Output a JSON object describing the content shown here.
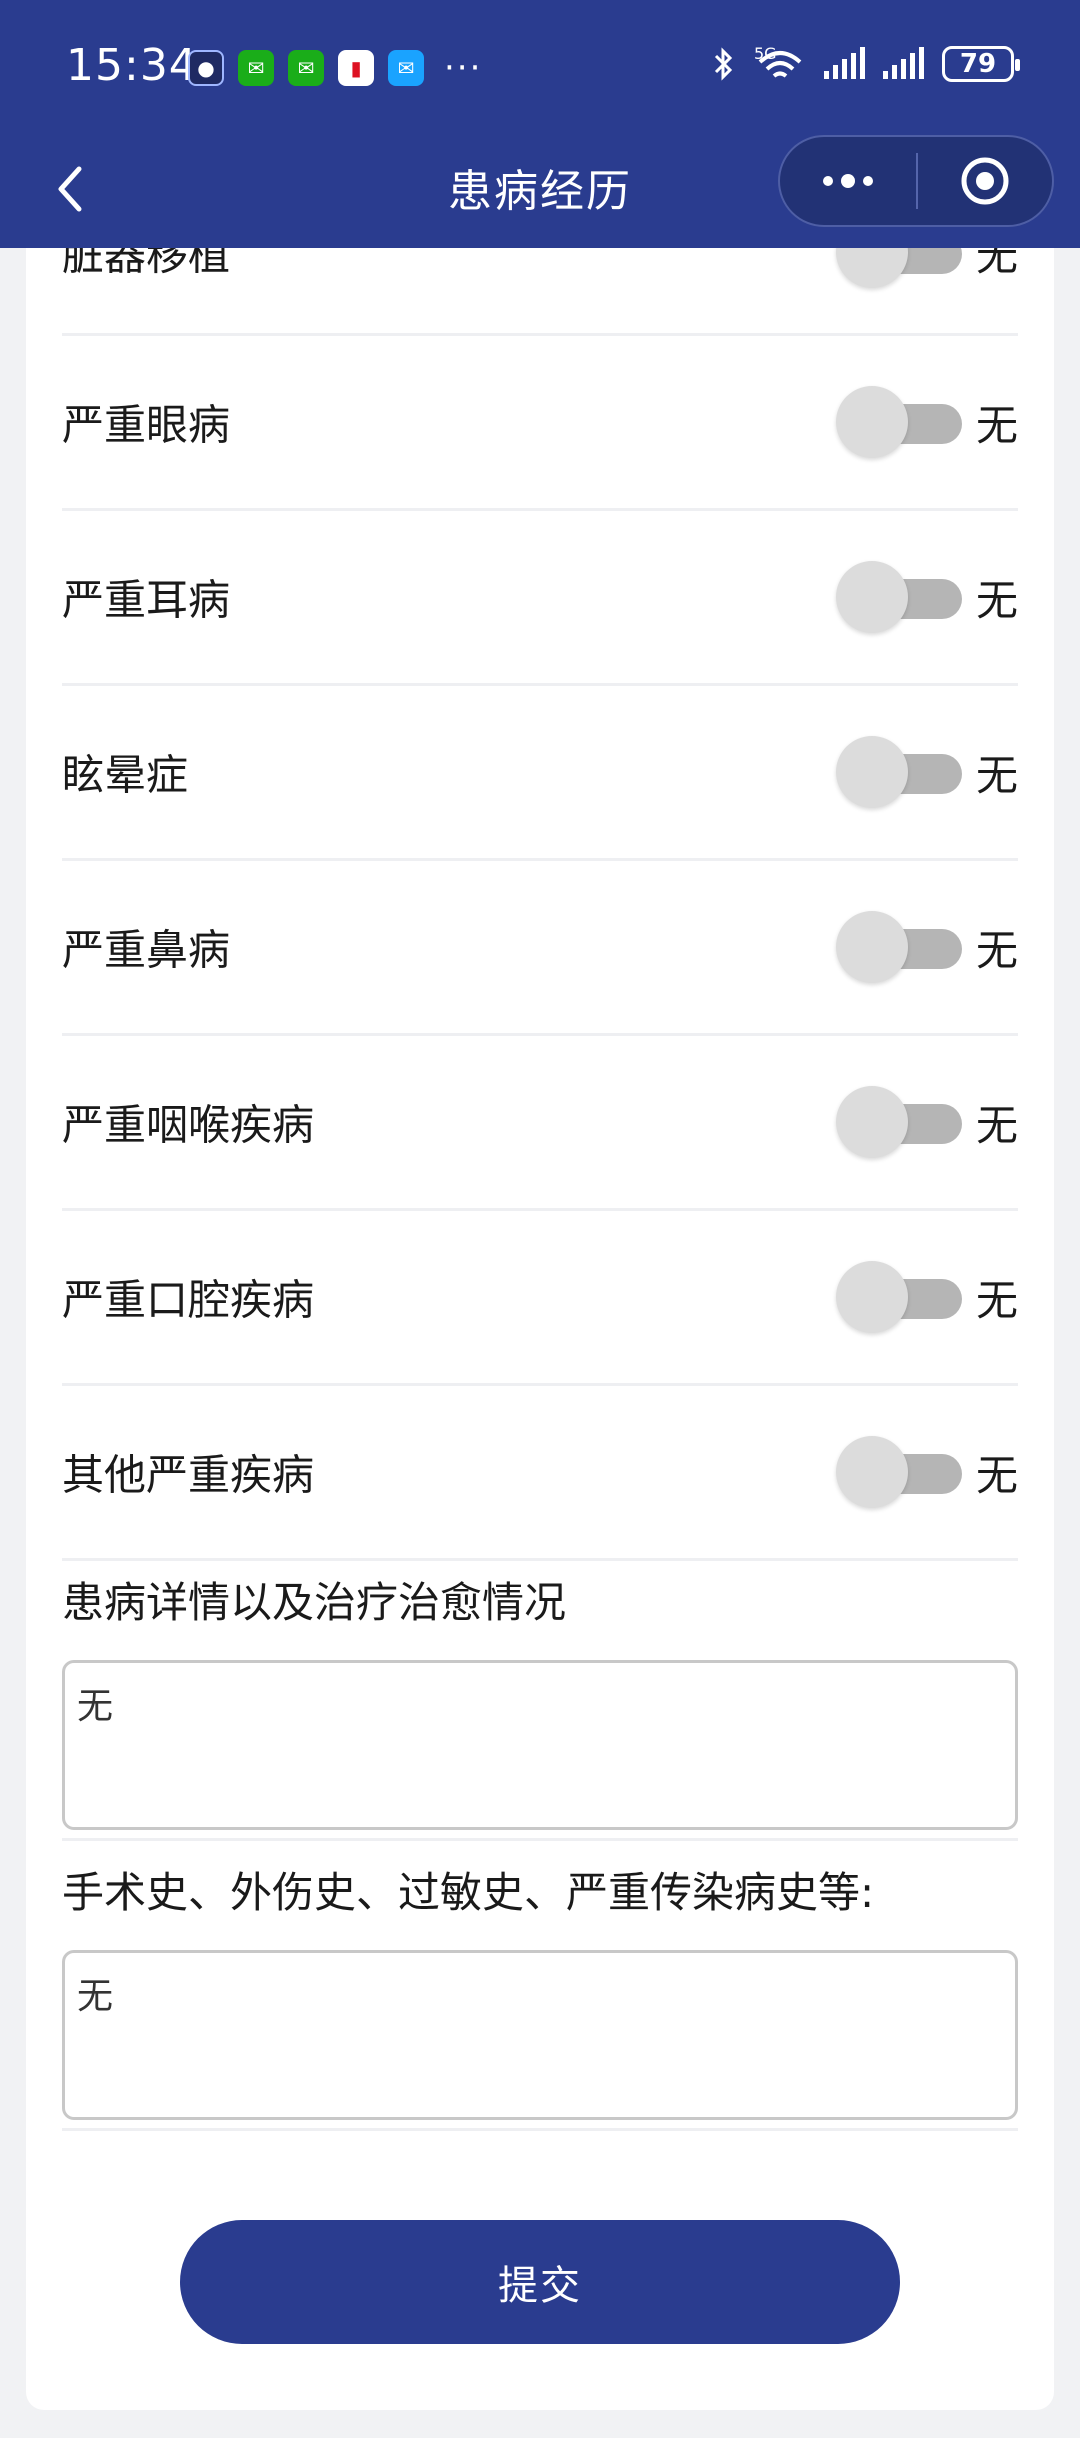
{
  "status_bar": {
    "time": "15:34",
    "more_indicator": "···",
    "battery": "79",
    "network_label": "5G"
  },
  "nav": {
    "title": "患病经历"
  },
  "conditions": [
    {
      "label": "脏器移植",
      "state": "无",
      "on": false
    },
    {
      "label": "严重眼病",
      "state": "无",
      "on": false
    },
    {
      "label": "严重耳病",
      "state": "无",
      "on": false
    },
    {
      "label": "眩晕症",
      "state": "无",
      "on": false
    },
    {
      "label": "严重鼻病",
      "state": "无",
      "on": false
    },
    {
      "label": "严重咽喉疾病",
      "state": "无",
      "on": false
    },
    {
      "label": "严重口腔疾病",
      "state": "无",
      "on": false
    },
    {
      "label": "其他严重疾病",
      "state": "无",
      "on": false
    }
  ],
  "details": {
    "label": "患病详情以及治疗治愈情况",
    "value": "无"
  },
  "history": {
    "label": "手术史、外伤史、过敏史、严重传染病史等:",
    "value": "无"
  },
  "submit_label": "提交",
  "colors": {
    "primary": "#2a3c8f",
    "background": "#f1f2f4",
    "toggle_off": "#b5b5b5"
  }
}
